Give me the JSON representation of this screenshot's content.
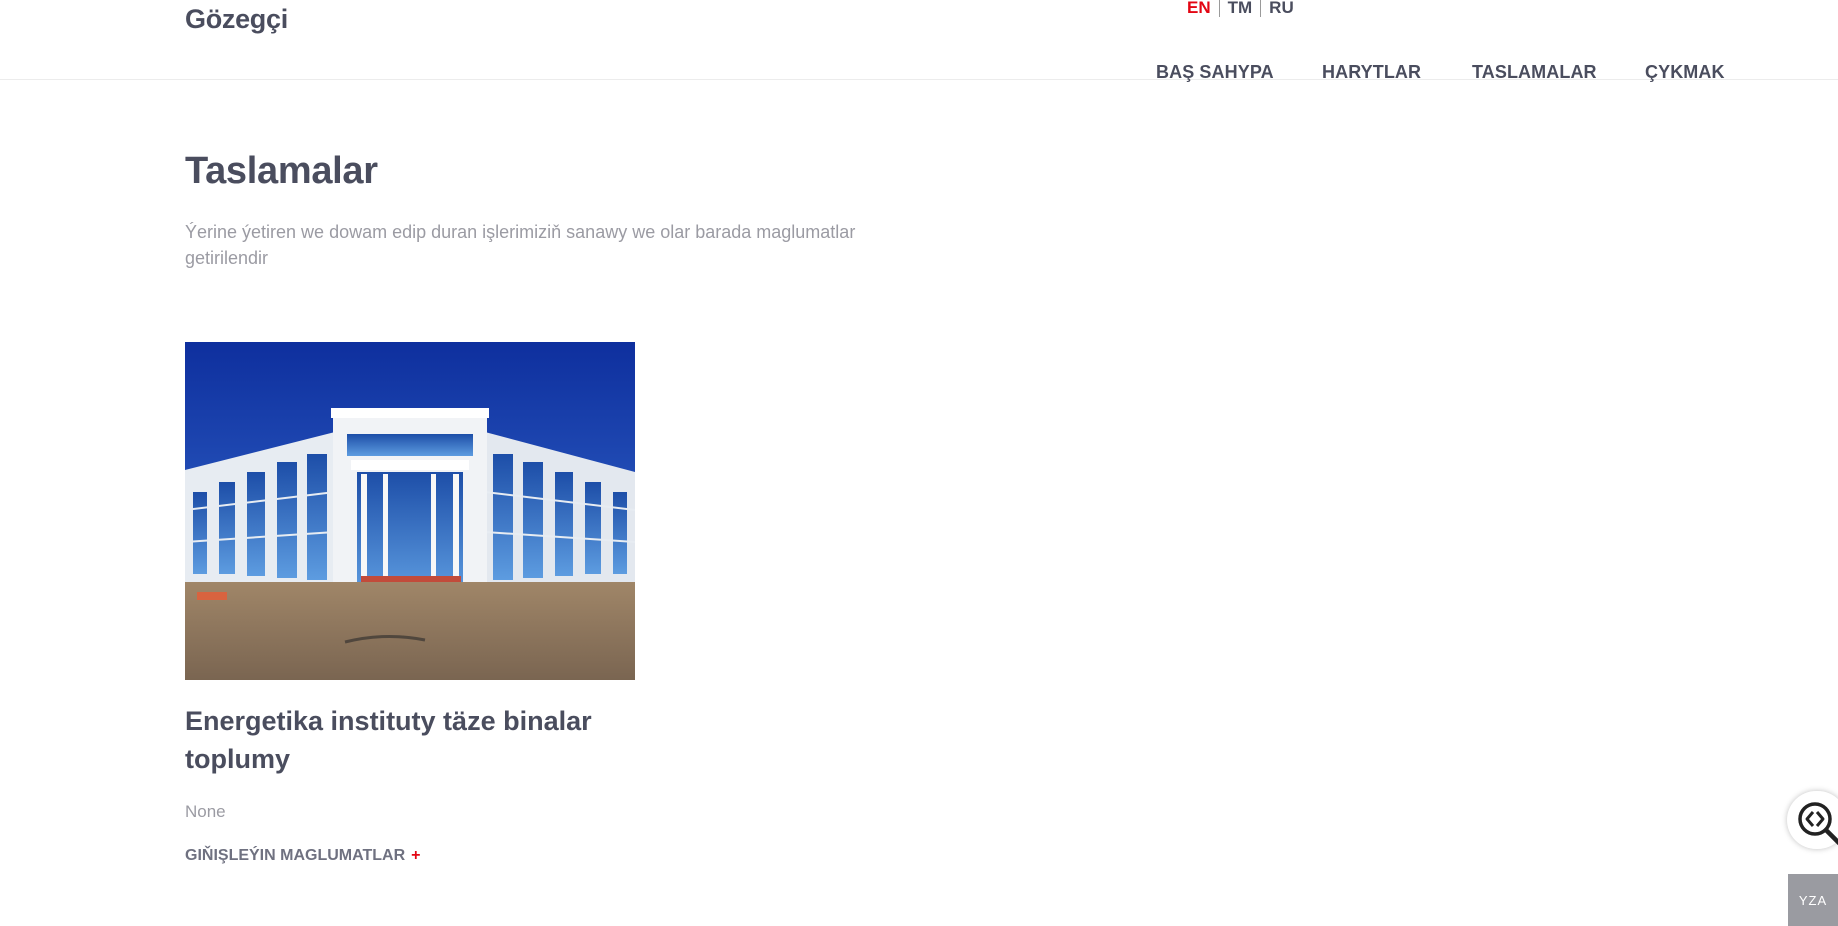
{
  "header": {
    "logo": "Gözegçi",
    "languages": [
      {
        "label": "EN",
        "active": true
      },
      {
        "label": "TM",
        "active": false
      },
      {
        "label": "RU",
        "active": false
      }
    ],
    "nav": [
      "BAŞ SAHYPA",
      "HARYTLAR",
      "TASLAMALAR",
      "ÇYKMAK"
    ]
  },
  "main": {
    "title": "Taslamalar",
    "subtitle": "Ýerine ýetiren we dowam edip duran işlerimiziň sanawy we olar barada maglumatlar getirilendir",
    "projects": [
      {
        "image": "building-photo",
        "title": "Energetika instituty täze binalar toplumy",
        "description": "None",
        "more_label": "GIŇIŞLEÝIN MAGLUMATLAR",
        "more_icon": "+"
      }
    ]
  },
  "widgets": {
    "float_icon": "code-search-icon",
    "corner_label": "YZA"
  },
  "colors": {
    "accent": "#e30613",
    "text": "#4a4d5e",
    "muted": "#9b9ba3",
    "sky": "#1f49b8"
  }
}
